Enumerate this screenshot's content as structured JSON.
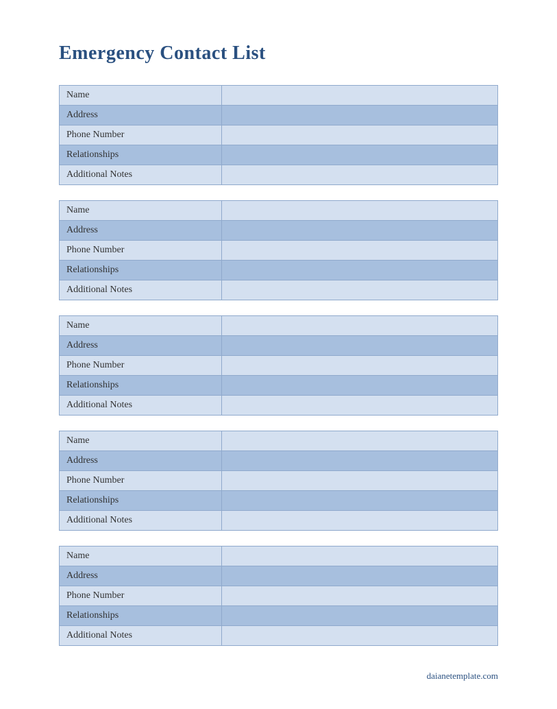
{
  "title": "Emergency Contact List",
  "row_labels": [
    "Name",
    "Address",
    "Phone Number",
    "Relationships",
    "Additional Notes"
  ],
  "contacts": [
    {
      "fields": [
        "",
        "",
        "",
        "",
        ""
      ]
    },
    {
      "fields": [
        "",
        "",
        "",
        "",
        ""
      ]
    },
    {
      "fields": [
        "",
        "",
        "",
        "",
        ""
      ]
    },
    {
      "fields": [
        "",
        "",
        "",
        "",
        ""
      ]
    },
    {
      "fields": [
        "",
        "",
        "",
        "",
        ""
      ]
    }
  ],
  "footer": "daianetemplate.com"
}
